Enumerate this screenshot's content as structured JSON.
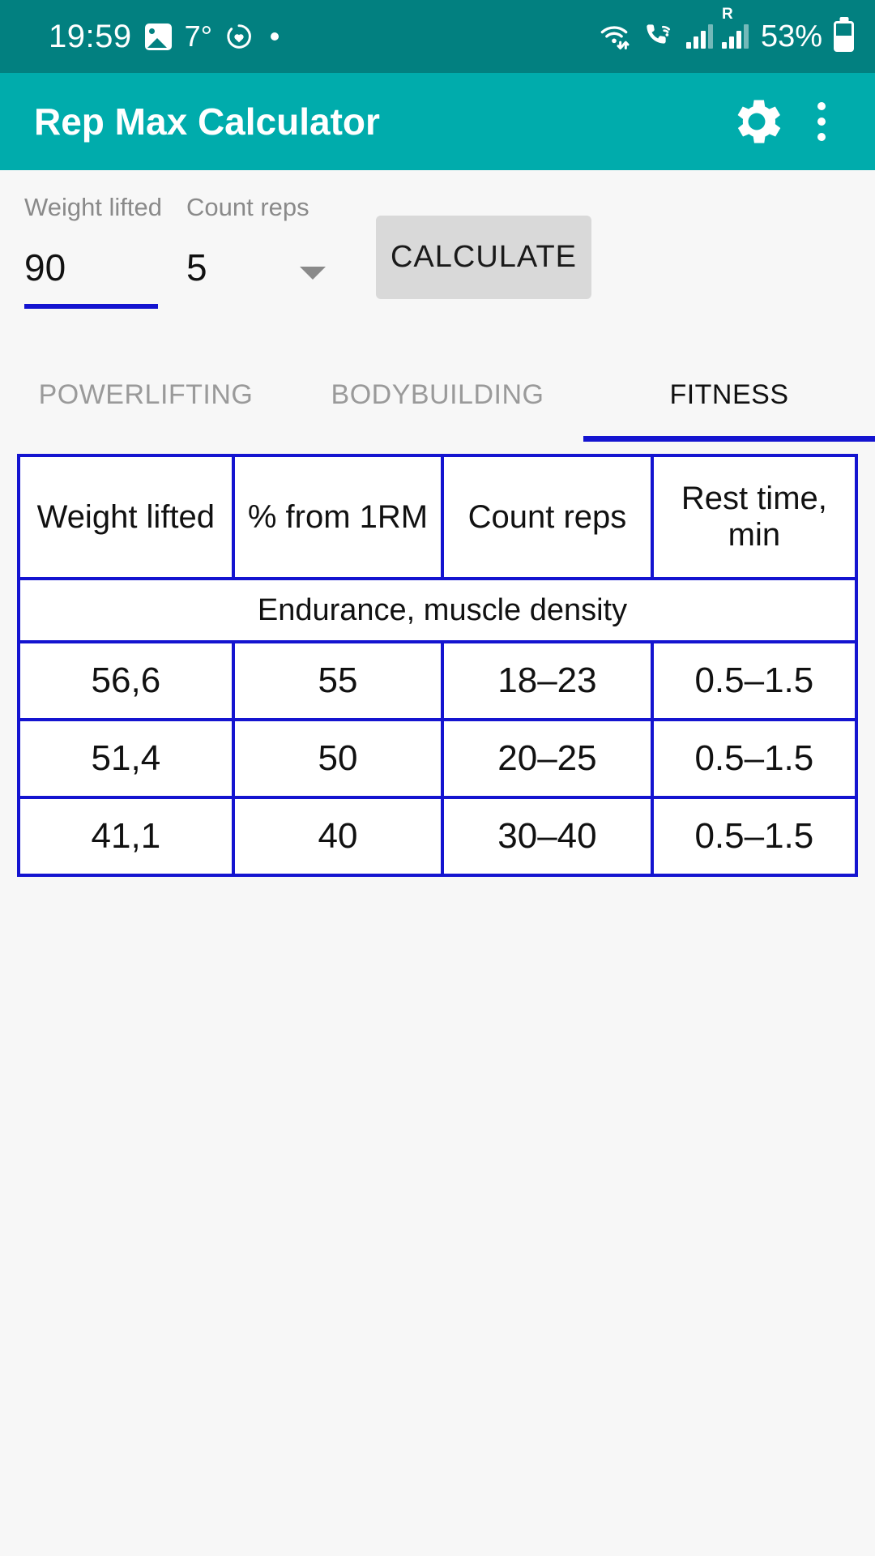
{
  "status_bar": {
    "clock": "19:59",
    "temperature": "7°",
    "battery_percent": "53%",
    "battery_level": 53,
    "roaming_label": "R",
    "icons": [
      "photo-icon",
      "health-icon",
      "notification-dot-icon",
      "wifi-icon",
      "call-wifi-icon",
      "signal-icon",
      "roaming-signal-icon",
      "battery-icon"
    ]
  },
  "app_bar": {
    "title": "Rep Max Calculator",
    "settings_icon": "gear-icon",
    "overflow_icon": "overflow-menu-icon",
    "background_color": "#00acac"
  },
  "inputs": {
    "weight": {
      "label": "Weight lifted",
      "value": "90",
      "underline_color": "#1414d0"
    },
    "reps": {
      "label": "Count reps",
      "value": "5",
      "caret_icon": "chevron-down-icon"
    },
    "calculate_button": {
      "label": "CALCULATE",
      "background_color": "#d9d9d9"
    }
  },
  "tabs": {
    "items": [
      {
        "label": "POWERLIFTING",
        "active": false
      },
      {
        "label": "BODYBUILDING",
        "active": false
      },
      {
        "label": "FITNESS",
        "active": true
      }
    ],
    "indicator_color": "#1414d0"
  },
  "table": {
    "border_color": "#1414d0",
    "headers": [
      "Weight lifted",
      "% from 1RM",
      "Count reps",
      "Rest time, min"
    ],
    "section_label": "Endurance, muscle density",
    "rows": [
      {
        "weight": "56,6",
        "percent": "55",
        "reps": "18–23",
        "rest": "0.5–1.5"
      },
      {
        "weight": "51,4",
        "percent": "50",
        "reps": "20–25",
        "rest": "0.5–1.5"
      },
      {
        "weight": "41,1",
        "percent": "40",
        "reps": "30–40",
        "rest": "0.5–1.5"
      }
    ]
  }
}
